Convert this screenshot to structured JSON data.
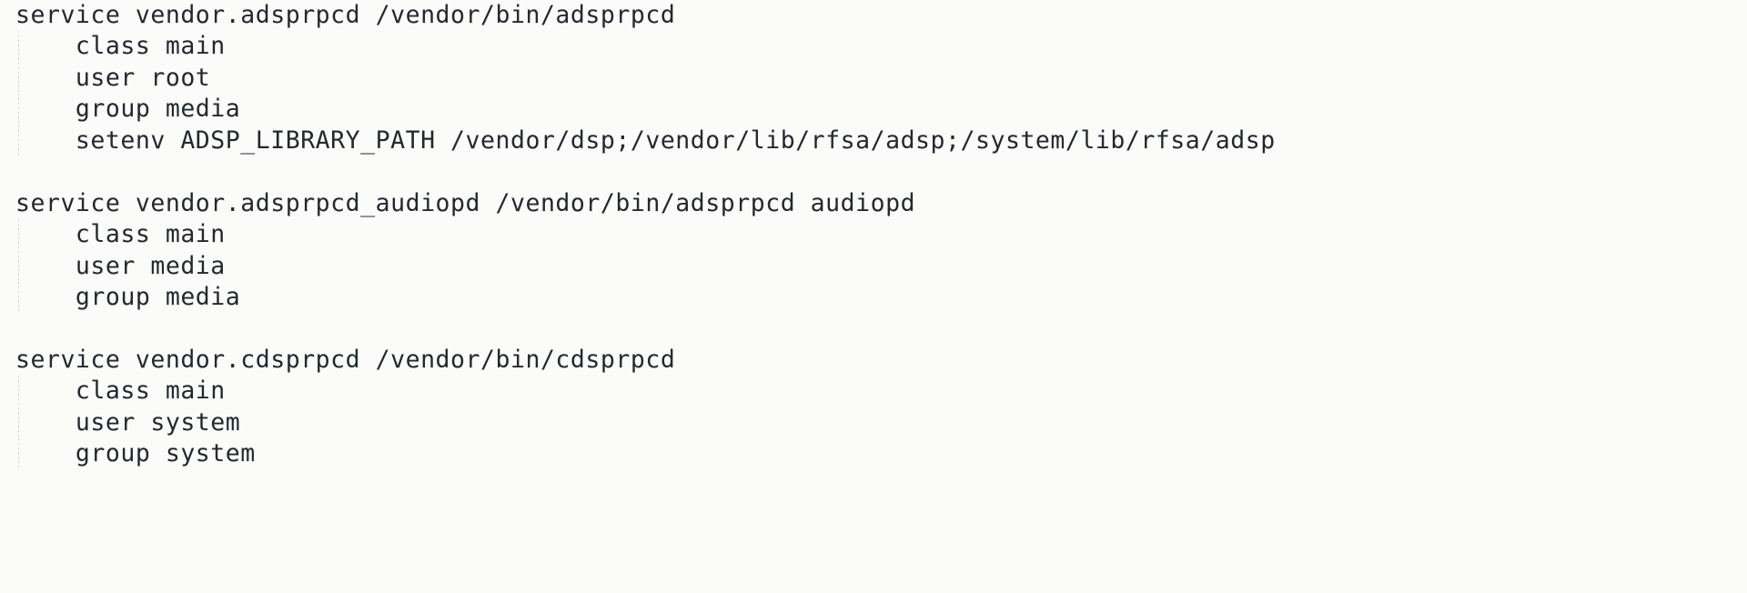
{
  "viewer": {
    "name": "code-snippet-viewer",
    "background_color": "#fbfbfa",
    "text_color": "#24292e",
    "indent_guide_color": "#cfcfcf",
    "font_size_px": 26.5,
    "line_height_px": 34.45
  },
  "code": {
    "language": "init-rc",
    "lines": [
      {
        "text": "service vendor.adsprpcd /vendor/bin/adsprpcd",
        "indented": false,
        "blank": false
      },
      {
        "text": "    class main",
        "indented": true,
        "blank": false
      },
      {
        "text": "    user root",
        "indented": true,
        "blank": false
      },
      {
        "text": "    group media",
        "indented": true,
        "blank": false
      },
      {
        "text": "    setenv ADSP_LIBRARY_PATH /vendor/dsp;/vendor/lib/rfsa/adsp;/system/lib/rfsa/adsp",
        "indented": true,
        "blank": false
      },
      {
        "text": " ",
        "indented": false,
        "blank": true
      },
      {
        "text": "service vendor.adsprpcd_audiopd /vendor/bin/adsprpcd audiopd",
        "indented": false,
        "blank": false
      },
      {
        "text": "    class main",
        "indented": true,
        "blank": false
      },
      {
        "text": "    user media",
        "indented": true,
        "blank": false
      },
      {
        "text": "    group media",
        "indented": true,
        "blank": false
      },
      {
        "text": " ",
        "indented": false,
        "blank": true
      },
      {
        "text": "service vendor.cdsprpcd /vendor/bin/cdsprpcd",
        "indented": false,
        "blank": false
      },
      {
        "text": "    class main",
        "indented": true,
        "blank": false
      },
      {
        "text": "    user system",
        "indented": true,
        "blank": false
      },
      {
        "text": "    group system",
        "indented": true,
        "blank": false
      }
    ]
  }
}
